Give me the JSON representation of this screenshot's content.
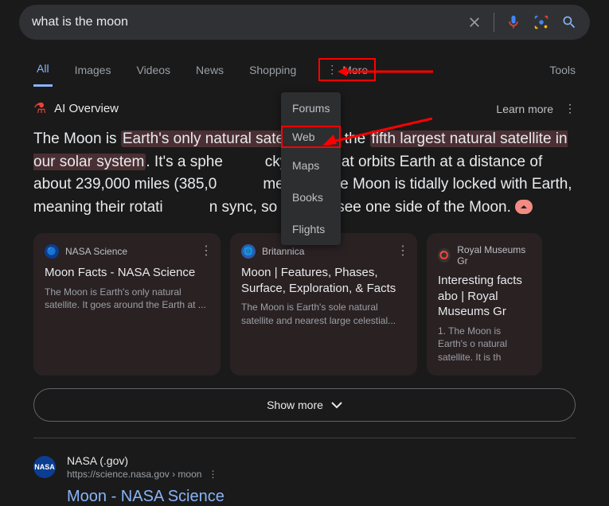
{
  "search": {
    "query": "what is the moon"
  },
  "tabs": {
    "all": "All",
    "images": "Images",
    "videos": "Videos",
    "news": "News",
    "shopping": "Shopping",
    "more": "More",
    "tools": "Tools"
  },
  "dropdown": {
    "forums": "Forums",
    "web": "Web",
    "maps": "Maps",
    "books": "Books",
    "flights": "Flights"
  },
  "ai": {
    "title": "AI Overview",
    "learn": "Learn more",
    "text_pre": "The Moon is ",
    "hl1": "Earth's only natural satell",
    "text_mid1": "the ",
    "hl2": "fifth largest natural satellite in our solar system",
    "text_post": ". It's a sphe          cky body that orbits Earth at a distance of about 239,000 miles (385,0           meters). The Moon is tidally locked with Earth, meaning their rotati           n sync, so we only see one side of the Moon. "
  },
  "cards": [
    {
      "src": "NASA Science",
      "title": "Moon Facts - NASA Science",
      "desc": "The Moon is Earth's only natural satellite. It goes around the Earth at ..."
    },
    {
      "src": "Britannica",
      "title": "Moon | Features, Phases, Surface, Exploration, & Facts",
      "desc": "The Moon is Earth's sole natural satellite and nearest large celestial..."
    },
    {
      "src": "Royal Museums Gr",
      "title": "Interesting facts abo | Royal Museums Gr",
      "desc": "1. The Moon is Earth's o natural satellite. It is th"
    }
  ],
  "showmore": "Show more",
  "result": {
    "src": "NASA (.gov)",
    "url": "https://science.nasa.gov › moon",
    "title": "Moon - NASA Science"
  }
}
